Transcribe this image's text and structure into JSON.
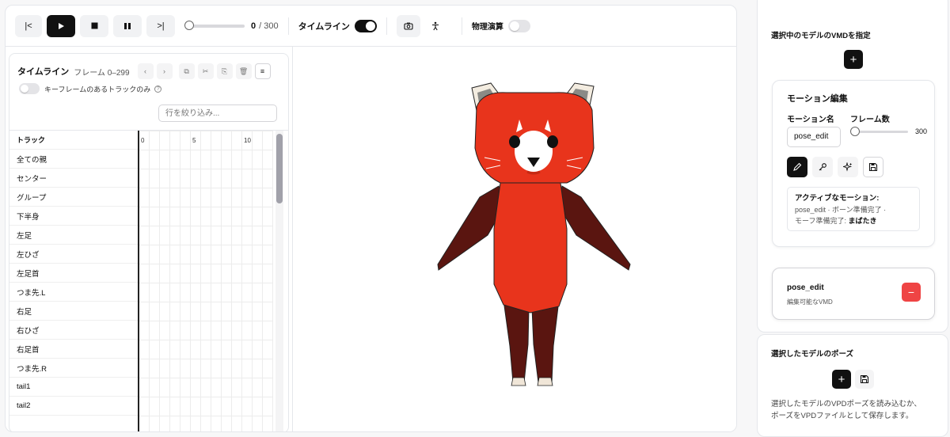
{
  "toolbar": {
    "frame_current": "0",
    "frame_total": "/ 300",
    "seek_fraction": 0,
    "timeline_label": "タイムライン",
    "timeline_on": true,
    "physics_label": "物理演算",
    "physics_on": false
  },
  "timeline": {
    "title": "タイムライン",
    "range": "フレーム 0–299",
    "keyframe_only_label": "キーフレームのあるトラックのみ",
    "filter_placeholder": "行を絞り込み...",
    "track_header": "トラック",
    "ticks": [
      "0",
      "5",
      "10"
    ],
    "tracks": [
      "全ての親",
      "センター",
      "グループ",
      "下半身",
      "左足",
      "左ひざ",
      "左足首",
      "つま先.L",
      "右足",
      "右ひざ",
      "右足首",
      "つま先.R",
      "tail1",
      "tail2"
    ]
  },
  "sidebar": {
    "vmd_title": "選択中のモデルのVMDを指定",
    "motion_edit": {
      "heading": "モーション編集",
      "name_label": "モーション名",
      "name_value": "pose_edit",
      "frames_label": "フレーム数",
      "frames_value": "300",
      "active_title": "アクティブなモーション:",
      "active_line1": "pose_edit · ボーン準備完了 ·",
      "active_line2_prefix": "モーフ準備完了:",
      "active_line2_value": "まばたき"
    },
    "vmd_item": {
      "name": "pose_edit",
      "subtitle": "編集可能なVMD"
    },
    "pose_title": "選択したモデルのポーズ",
    "pose_desc_line1": "選択したモデルのVPDポーズを読み込むか、",
    "pose_desc_line2": "ポーズをVPDファイルとして保存します。"
  },
  "colors": {
    "accent": "#111111",
    "danger": "#ef4444",
    "panda_red": "#e8341c",
    "panda_dark": "#5a1510"
  }
}
